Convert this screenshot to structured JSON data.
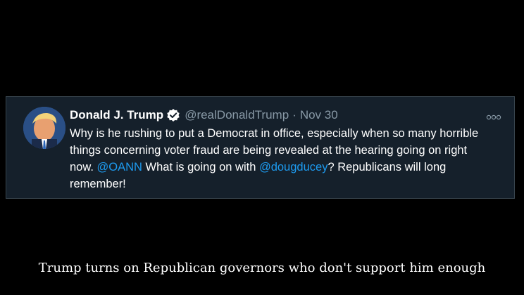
{
  "tweet": {
    "display_name": "Donald J. Trump",
    "handle": "@realDonaldTrump",
    "separator": "·",
    "date": "Nov 30",
    "text_parts": {
      "part1": "Why is he rushing to put a Democrat in office, especially when so many horrible things concerning voter fraud are being revealed at the hearing going on right now. ",
      "mention1": "@OANN",
      "part2": " What is going on with ",
      "mention2": "@dougducey",
      "part3": "? Republicans will long remember!"
    },
    "icons": {
      "verified": "verified-badge-icon",
      "more": "more-options-icon",
      "avatar": "profile-avatar"
    }
  },
  "caption": "Trump turns on Republican governors who don't support him enough",
  "colors": {
    "background": "#000000",
    "card": "#15202b",
    "mention": "#1d9bf0",
    "secondary_text": "#8899a6",
    "verified": "#1d9bf0"
  }
}
